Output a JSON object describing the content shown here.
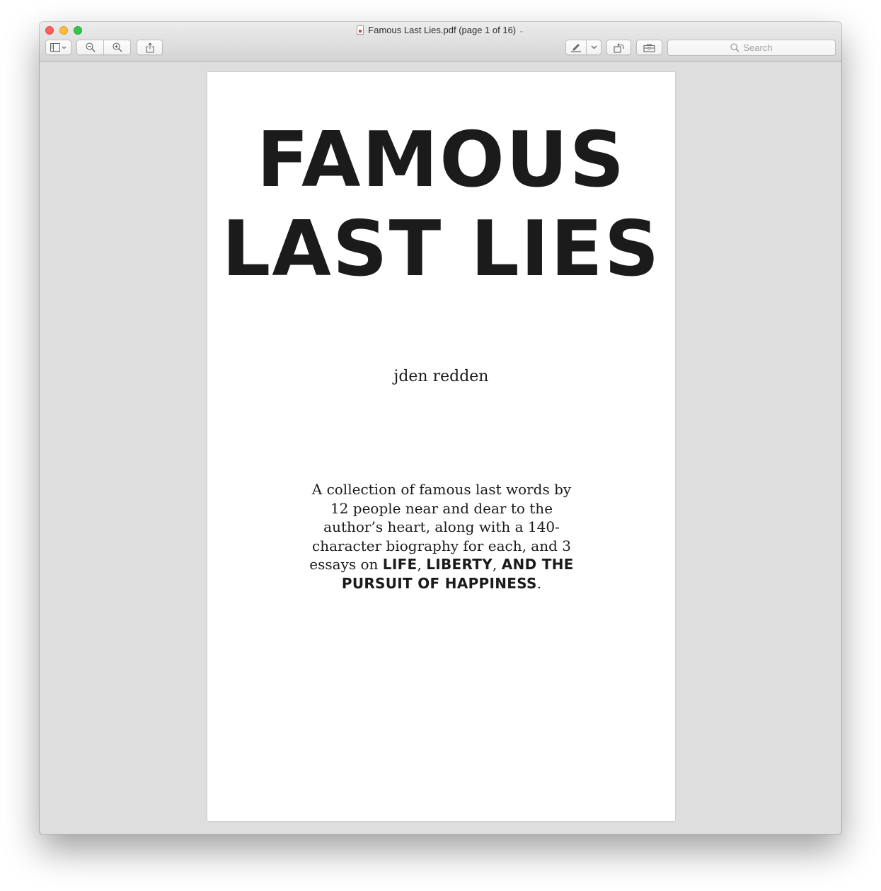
{
  "window": {
    "title": "Famous Last Lies.pdf (page 1 of 16)",
    "title_chevron": "⌄"
  },
  "toolbar": {
    "search_placeholder": "Search"
  },
  "icons": {
    "sidebar_toggle": "sidebar-icon",
    "zoom_out": "zoom-out-icon",
    "zoom_in": "zoom-in-icon",
    "share": "share-icon",
    "markup": "pen-icon",
    "rotate": "rotate-icon",
    "toolbox": "toolbox-icon",
    "search": "search-icon"
  },
  "colors": {
    "close": "#fc605c",
    "minimize": "#fdbc40",
    "maximize": "#34c84a",
    "canvas": "#dedede",
    "page": "#ffffff",
    "text": "#1b1b1b"
  },
  "document": {
    "title_line1": "FAMOUS",
    "title_line2": "LAST LIES",
    "author": "jden redden",
    "description_plain": "A collection of famous last words by 12 people near and dear to the author’s heart, along with a 140-character biography for each, and 3 essays on",
    "emph_life": "LIFE",
    "sep_1": ", ",
    "emph_liberty": "LIBERTY",
    "sep_2": ", ",
    "emph_rest": "AND THE PURSUIT OF HAPPINESS",
    "end_period": "."
  }
}
